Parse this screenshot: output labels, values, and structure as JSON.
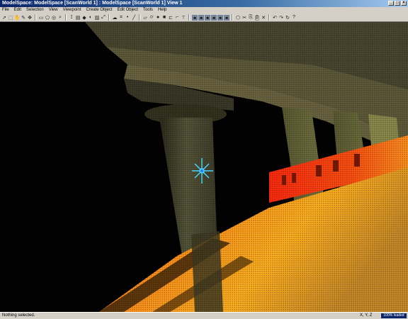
{
  "window": {
    "title": "ModelSpace: ModelSpace [ScanWorld 1] : ModelSpace [ScanWorld 1] View 1"
  },
  "menu": [
    "File",
    "Edit",
    "Selection",
    "View",
    "Viewpoint",
    "Create Object",
    "Edit Object",
    "Tools",
    "Help"
  ],
  "toolbar_icons": [
    "select-arrow-icon",
    "select-fence-icon",
    "pan-icon",
    "edit-icon",
    "move-icon",
    "rectangle-icon",
    "polygon-icon",
    "seek-icon",
    "zoom-icon",
    "measure-icon",
    "layers-icon",
    "object-icon",
    "color-icon",
    "patch-icon",
    "fit-icon",
    "undo-icon",
    "redo-icon",
    "cut-icon",
    "copy-icon",
    "paste-icon",
    "delete-icon"
  ],
  "status": {
    "message": "Nothing selected.",
    "coords": "X, Y, Z",
    "loaded": "100% loaded"
  },
  "colors": {
    "title_start": "#0a246a",
    "cloud_orange": "#ff8a1a",
    "cloud_red": "#ff3a10",
    "pillar": "#5a5a40",
    "crosshair": "#4ad8ff"
  }
}
